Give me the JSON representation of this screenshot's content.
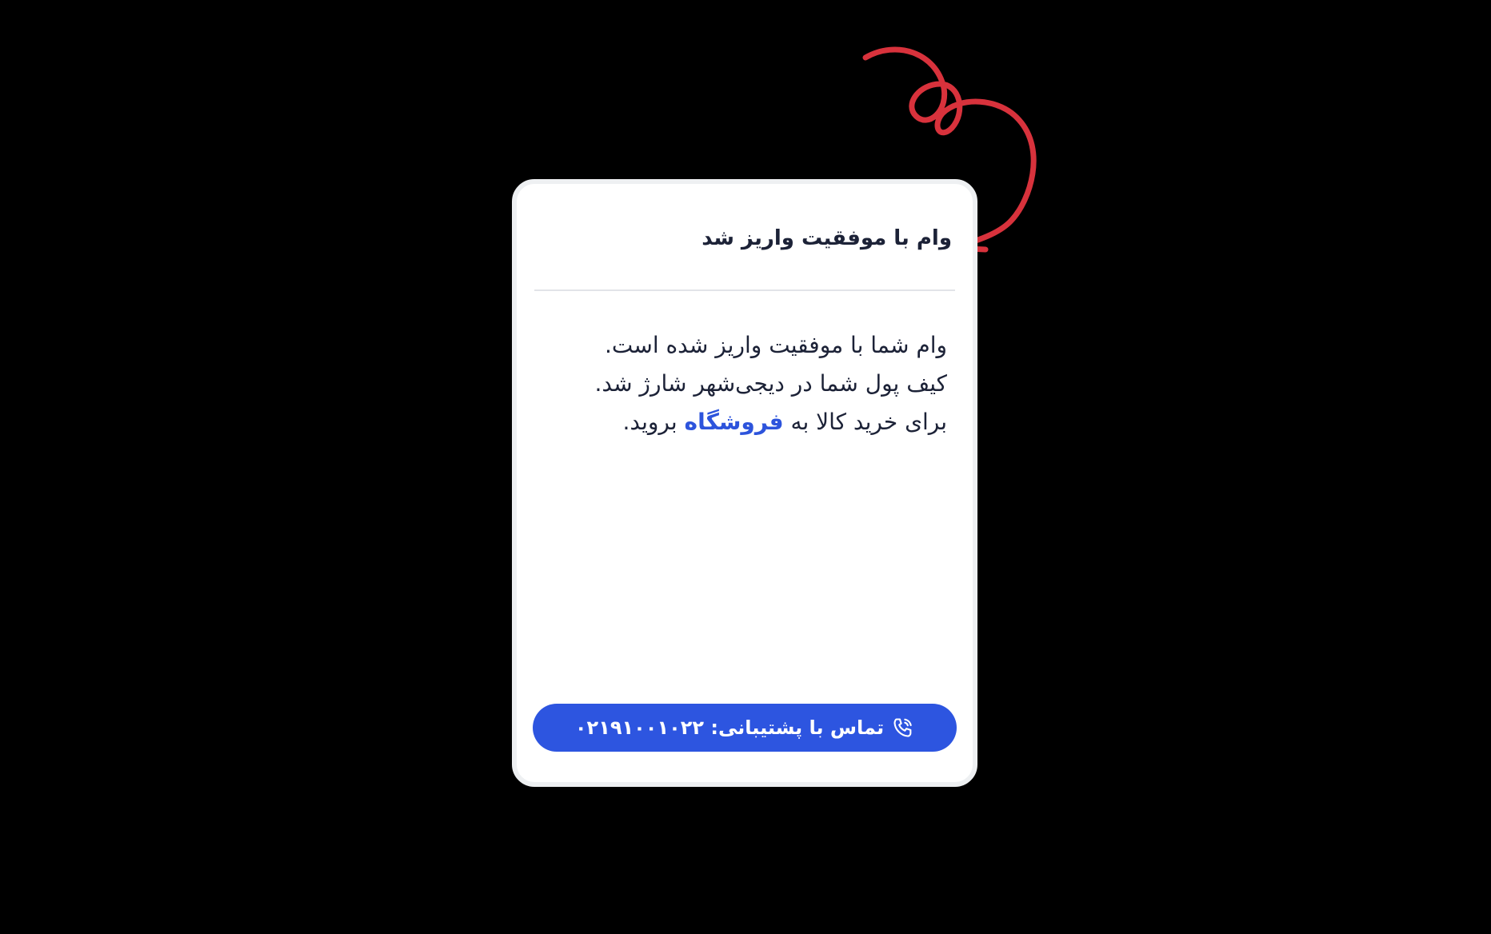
{
  "card": {
    "title": "وام با موفقیت واریز شد",
    "message": {
      "line1": "وام شما با موفقیت واریز شده است.",
      "line2": "کیف پول شما در دیجی‌شهر شارژ شد.",
      "line3_before": "برای خرید کالا به ",
      "store_link": "فروشگاه",
      "line3_after": " بروید."
    },
    "support_button": {
      "label": "تماس با پشتیبانی: ۰۲۱۹۱۰۰۱۰۲۲",
      "icon": "phone-call-icon"
    }
  },
  "annotation": {
    "icon": "red-curly-arrow",
    "color": "#d8323c"
  },
  "colors": {
    "accent": "#2d55e0",
    "text": "#1c2237",
    "background": "#000000",
    "card": "#ffffff"
  }
}
